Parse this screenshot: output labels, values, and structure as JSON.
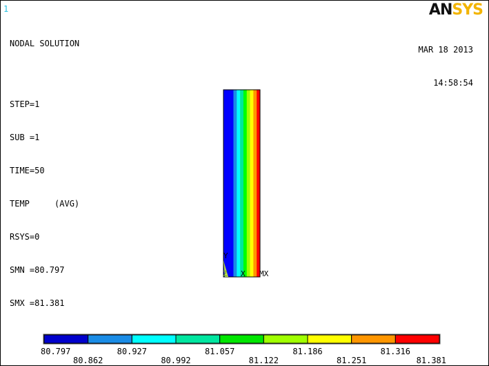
{
  "window": {
    "number": "1"
  },
  "logo": {
    "dark": "AN",
    "gold": "SYS"
  },
  "solution_info": {
    "title": "NODAL SOLUTION",
    "step": "STEP=1",
    "sub": "SUB =1",
    "time": "TIME=50",
    "temp": "TEMP     (AVG)",
    "rsys": "RSYS=0",
    "smn": "SMN =80.797",
    "smx": "SMX =81.381"
  },
  "datetime": {
    "date": "MAR 18 2013",
    "time": "14:58:54"
  },
  "model": {
    "axis_y": "Y",
    "axis_z": "Z",
    "axis_x": "X",
    "marker_mx": "MX",
    "bands": [
      {
        "color": "#0000ff"
      },
      {
        "color": "#0000ff"
      },
      {
        "color": "#0000ff"
      },
      {
        "color": "#1a8ce6"
      },
      {
        "color": "#00ffff"
      },
      {
        "color": "#00e6a0"
      },
      {
        "color": "#00ff00"
      },
      {
        "color": "#a0ff00"
      },
      {
        "color": "#ffff00"
      },
      {
        "color": "#ff9600"
      },
      {
        "color": "#ff0000"
      }
    ]
  },
  "legend": {
    "colors": [
      "#0000cc",
      "#1a8ce6",
      "#00ffff",
      "#00e6a0",
      "#00e600",
      "#a0ff00",
      "#ffff00",
      "#ff9600",
      "#ff0000"
    ],
    "ticks": [
      "80.797",
      "80.862",
      "80.927",
      "80.992",
      "81.057",
      "81.122",
      "81.186",
      "81.251",
      "81.316",
      "81.381"
    ]
  }
}
